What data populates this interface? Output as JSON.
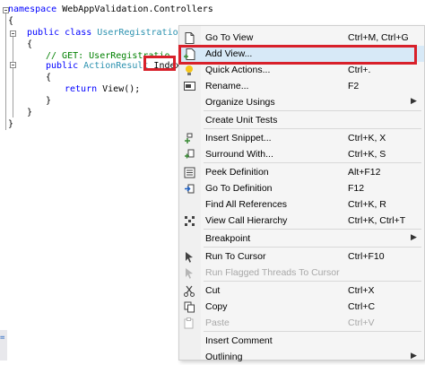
{
  "editor": {
    "lines": [
      {
        "indent": 0,
        "parts": [
          {
            "cls": "kw",
            "t": "namespace"
          },
          {
            "cls": "",
            "t": " WebAppValidation.Controllers"
          }
        ]
      },
      {
        "indent": 0,
        "parts": [
          {
            "cls": "",
            "t": "{"
          }
        ]
      },
      {
        "indent": 1,
        "parts": [
          {
            "cls": "kw",
            "t": "public"
          },
          {
            "cls": "",
            "t": " "
          },
          {
            "cls": "kw",
            "t": "class"
          },
          {
            "cls": "",
            "t": " "
          },
          {
            "cls": "ty",
            "t": "UserRegistrationCo"
          }
        ]
      },
      {
        "indent": 1,
        "parts": [
          {
            "cls": "",
            "t": "{"
          }
        ]
      },
      {
        "indent": 2,
        "parts": [
          {
            "cls": "cm",
            "t": "// GET: UserRegistratio"
          }
        ]
      },
      {
        "indent": 2,
        "parts": [
          {
            "cls": "kw",
            "t": "public"
          },
          {
            "cls": "",
            "t": " "
          },
          {
            "cls": "ty",
            "t": "ActionResult"
          },
          {
            "cls": "",
            "t": " Index()"
          }
        ]
      },
      {
        "indent": 2,
        "parts": [
          {
            "cls": "",
            "t": "{"
          }
        ]
      },
      {
        "indent": 3,
        "parts": [
          {
            "cls": "kw",
            "t": "return"
          },
          {
            "cls": "",
            "t": " View();"
          }
        ]
      },
      {
        "indent": 2,
        "parts": [
          {
            "cls": "",
            "t": "}"
          }
        ]
      },
      {
        "indent": 1,
        "parts": [
          {
            "cls": "",
            "t": "}"
          }
        ]
      },
      {
        "indent": 0,
        "parts": [
          {
            "cls": "",
            "t": "}"
          }
        ]
      }
    ],
    "status_text": "="
  },
  "menu": {
    "items": [
      {
        "id": "go-to-view",
        "label": "Go To View",
        "shortcut": "Ctrl+M, Ctrl+G",
        "icon": "document-icon",
        "disabled": false,
        "submenu": false
      },
      {
        "id": "add-view",
        "label": "Add View...",
        "shortcut": "",
        "icon": "add-document-icon",
        "disabled": false,
        "submenu": false,
        "selected": true
      },
      {
        "id": "quick-actions",
        "label": "Quick Actions...",
        "shortcut": "Ctrl+.",
        "icon": "lightbulb-icon",
        "disabled": false,
        "submenu": false
      },
      {
        "id": "rename",
        "label": "Rename...",
        "shortcut": "F2",
        "icon": "rename-icon",
        "disabled": false,
        "submenu": false
      },
      {
        "id": "organize-usings",
        "label": "Organize Usings",
        "shortcut": "",
        "icon": "",
        "disabled": false,
        "submenu": true
      },
      {
        "id": "sep",
        "separator": true
      },
      {
        "id": "create-unit-tests",
        "label": "Create Unit Tests",
        "shortcut": "",
        "icon": "",
        "disabled": false,
        "submenu": false
      },
      {
        "id": "sep",
        "separator": true
      },
      {
        "id": "insert-snippet",
        "label": "Insert Snippet...",
        "shortcut": "Ctrl+K, X",
        "icon": "snippet-icon",
        "disabled": false,
        "submenu": false
      },
      {
        "id": "surround-with",
        "label": "Surround With...",
        "shortcut": "Ctrl+K, S",
        "icon": "surround-icon",
        "disabled": false,
        "submenu": false
      },
      {
        "id": "sep",
        "separator": true
      },
      {
        "id": "peek-definition",
        "label": "Peek Definition",
        "shortcut": "Alt+F12",
        "icon": "peek-icon",
        "disabled": false,
        "submenu": false
      },
      {
        "id": "go-to-definition",
        "label": "Go To Definition",
        "shortcut": "F12",
        "icon": "goto-definition-icon",
        "disabled": false,
        "submenu": false
      },
      {
        "id": "find-all-references",
        "label": "Find All References",
        "shortcut": "Ctrl+K, R",
        "icon": "",
        "disabled": false,
        "submenu": false
      },
      {
        "id": "view-call-hierarchy",
        "label": "View Call Hierarchy",
        "shortcut": "Ctrl+K, Ctrl+T",
        "icon": "call-hierarchy-icon",
        "disabled": false,
        "submenu": false
      },
      {
        "id": "sep",
        "separator": true
      },
      {
        "id": "breakpoint",
        "label": "Breakpoint",
        "shortcut": "",
        "icon": "",
        "disabled": false,
        "submenu": true
      },
      {
        "id": "sep",
        "separator": true
      },
      {
        "id": "run-to-cursor",
        "label": "Run To Cursor",
        "shortcut": "Ctrl+F10",
        "icon": "run-cursor-icon",
        "disabled": false,
        "submenu": false
      },
      {
        "id": "run-flagged-threads",
        "label": "Run Flagged Threads To Cursor",
        "shortcut": "",
        "icon": "run-flagged-icon",
        "disabled": true,
        "submenu": false
      },
      {
        "id": "sep",
        "separator": true
      },
      {
        "id": "cut",
        "label": "Cut",
        "shortcut": "Ctrl+X",
        "icon": "scissors-icon",
        "disabled": false,
        "submenu": false
      },
      {
        "id": "copy",
        "label": "Copy",
        "shortcut": "Ctrl+C",
        "icon": "copy-icon",
        "disabled": false,
        "submenu": false
      },
      {
        "id": "paste",
        "label": "Paste",
        "shortcut": "Ctrl+V",
        "icon": "paste-icon",
        "disabled": true,
        "submenu": false
      },
      {
        "id": "sep",
        "separator": true
      },
      {
        "id": "insert-comment",
        "label": "Insert Comment",
        "shortcut": "",
        "icon": "",
        "disabled": false,
        "submenu": false
      },
      {
        "id": "outlining",
        "label": "Outlining",
        "shortcut": "",
        "icon": "",
        "disabled": false,
        "submenu": true
      }
    ],
    "submenu_glyph": "▶"
  },
  "colors": {
    "highlight": "#d8202a",
    "keyword": "#0000ff",
    "comment": "#008000",
    "type": "#2b91af"
  }
}
